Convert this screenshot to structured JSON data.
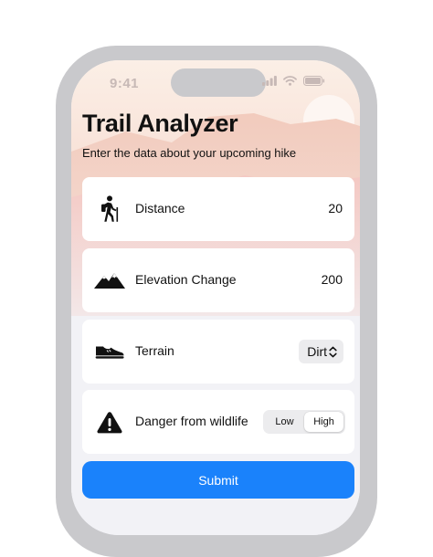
{
  "status": {
    "time": "9:41"
  },
  "header": {
    "title": "Trail Analyzer",
    "subtitle": "Enter the data about your upcoming hike"
  },
  "rows": [
    {
      "icon": "hiker-icon",
      "label": "Distance",
      "value": "20"
    },
    {
      "icon": "mountains-icon",
      "label": "Elevation Change",
      "value": "200"
    },
    {
      "icon": "shoe-icon",
      "label": "Terrain",
      "value": "Dirt"
    },
    {
      "icon": "warning-triangle-icon",
      "label": "Danger from wildlife",
      "options": [
        "Low",
        "High"
      ],
      "selected": "High"
    }
  ],
  "submit": {
    "label": "Submit"
  },
  "colors": {
    "accent": "#1a82fb",
    "card_background": "#ffffff",
    "screen_background": "#f2f2f6",
    "device_frame": "#c9c9cc"
  }
}
